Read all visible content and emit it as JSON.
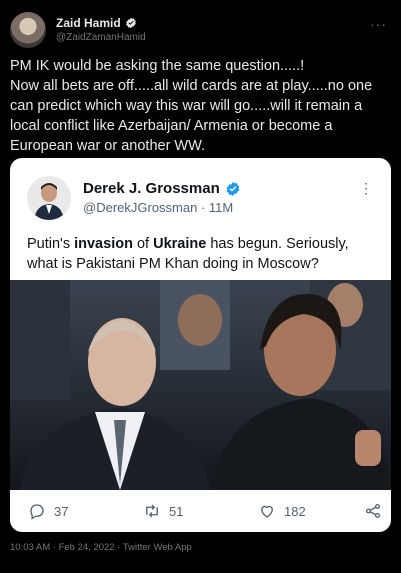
{
  "author": {
    "name": "Zaid Hamid",
    "handle": "@ZaidZamanHamid"
  },
  "tweet": {
    "text": "PM IK would be asking the same question.....!\nNow all bets are off.....all wild cards are at play.....no one can predict which way this war will go.....will it remain a local conflict like Azerbaijan/ Armenia or become a European war or another WW."
  },
  "quoted": {
    "name": "Derek J. Grossman",
    "handle_time": "@DerekJGrossman · 11M",
    "text_parts": [
      "Putin's ",
      "invasion",
      " of ",
      "Ukraine",
      " has begun. Seriously, what is Pakistani PM Khan doing in Moscow?"
    ],
    "stats": {
      "replies": "37",
      "retweets": "51",
      "likes": "182"
    }
  },
  "footer": "10:03 AM · Feb 24, 2022 · Twitter Web App",
  "colors": {
    "verified": "#1d9bf0",
    "background": "#000000"
  }
}
